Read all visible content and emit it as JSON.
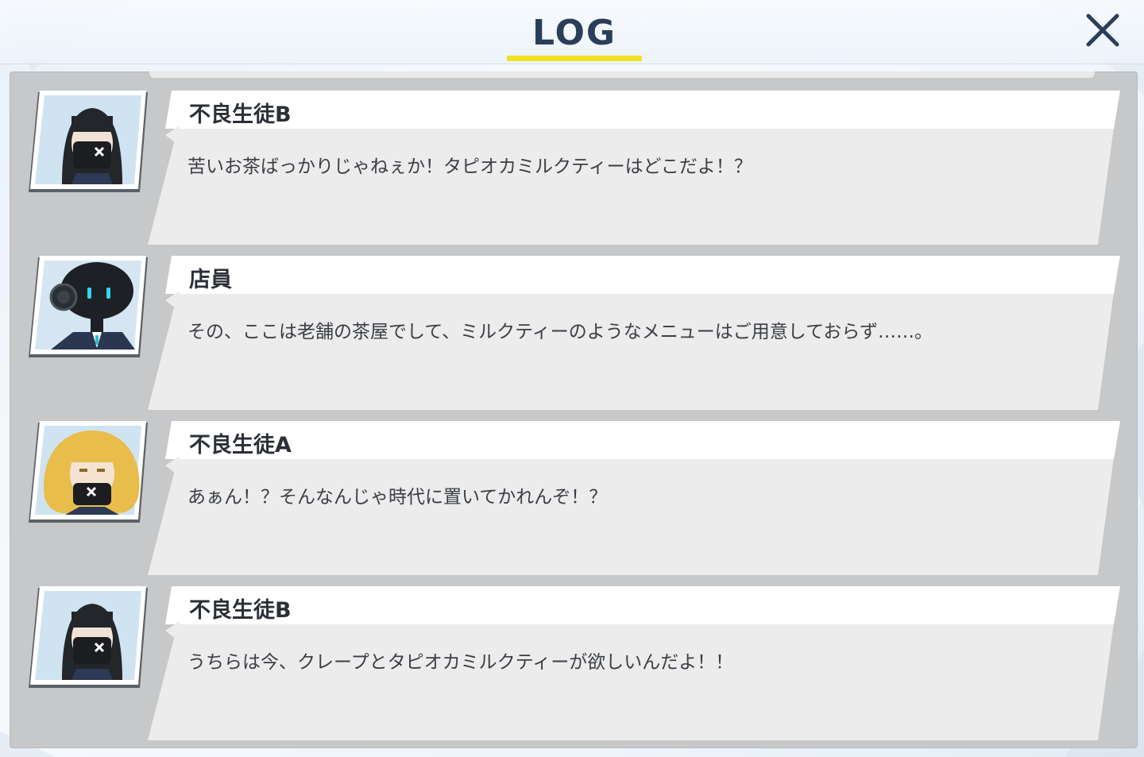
{
  "header": {
    "title": "LOG",
    "close_label": "Close"
  },
  "colors": {
    "title": "#2a3e59",
    "underline": "#f4e123",
    "panel": "#c7c8c9",
    "bubble": "#ececec",
    "name_strip": "#ffffff"
  },
  "log": {
    "entries": [
      {
        "speaker": "不良生徒B",
        "message": "苦いお茶ばっかりじゃねぇか！タピオカミルクティーはどこだよ！？",
        "avatar": "delinquent-b-portrait"
      },
      {
        "speaker": "店員",
        "message": "その、ここは老舗の茶屋でして、ミルクティーのようなメニューはご用意しておらず……。",
        "avatar": "robot-clerk-portrait"
      },
      {
        "speaker": "不良生徒A",
        "message": "あぁん！？そんなんじゃ時代に置いてかれんぞ！？",
        "avatar": "delinquent-a-portrait"
      },
      {
        "speaker": "不良生徒B",
        "message": "うちらは今、クレープとタピオカミルクティーが欲しいんだよ！！",
        "avatar": "delinquent-b-portrait"
      }
    ]
  }
}
